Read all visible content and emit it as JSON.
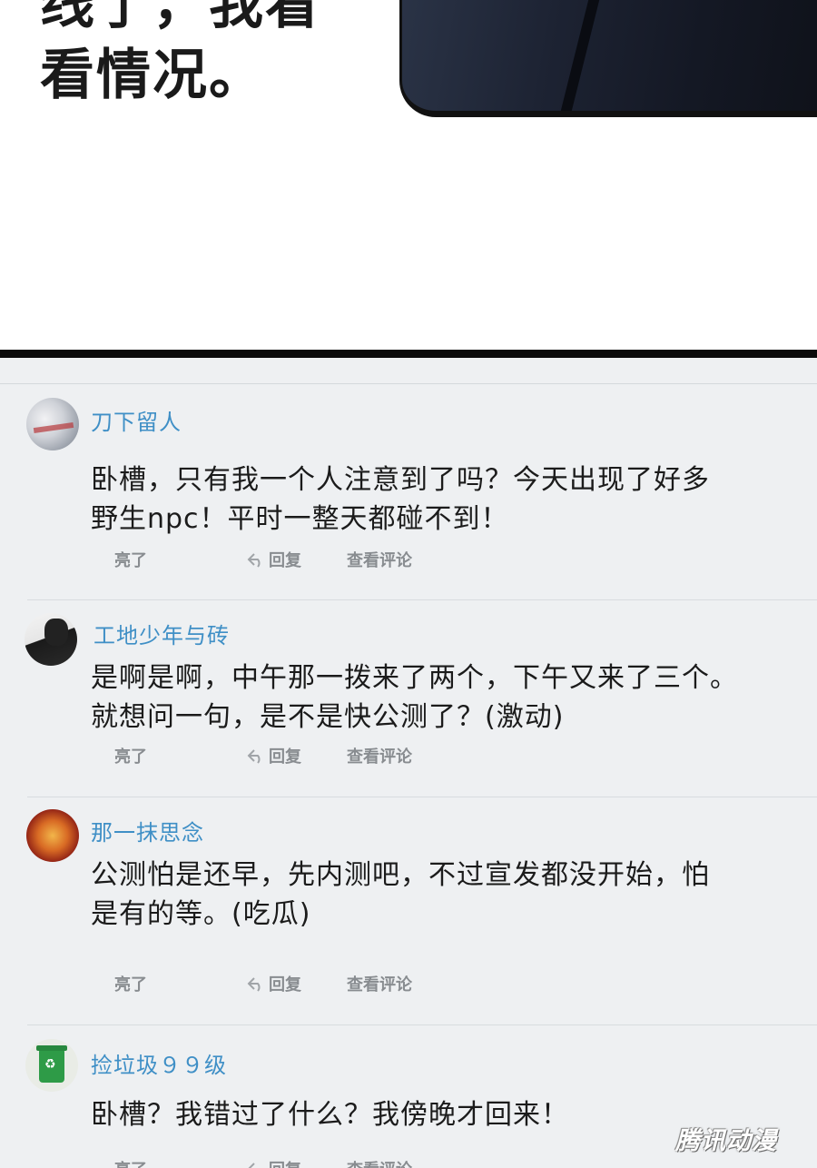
{
  "panel": {
    "bubble_lines": [
      "线了，我看",
      "看情况。"
    ]
  },
  "comments": [
    {
      "username": "刀下留人",
      "body_lines": [
        "卧槽，只有我一个人注意到了吗？今天出现了好多",
        "野生npc！平时一整天都碰不到！"
      ],
      "actions": {
        "like": "亮了",
        "reply": "回复",
        "view": "查看评论"
      }
    },
    {
      "username": "工地少年与砖",
      "body_lines": [
        "是啊是啊，中午那一拨来了两个，下午又来了三个。",
        "就想问一句，是不是快公测了？(激动)"
      ],
      "actions": {
        "like": "亮了",
        "reply": "回复",
        "view": "查看评论"
      }
    },
    {
      "username": "那一抹思念",
      "body_lines": [
        "公测怕是还早，先内测吧，不过宣发都没开始，怕",
        "是有的等。(吃瓜)"
      ],
      "actions": {
        "like": "亮了",
        "reply": "回复",
        "view": "查看评论"
      }
    },
    {
      "username": "捡垃圾９９级",
      "body_lines": [
        "卧槽？我错过了什么？我傍晚才回来！"
      ],
      "actions": {
        "like": "亮了",
        "reply": "回复",
        "view": "查看评论"
      }
    }
  ],
  "icons": {
    "reply": "reply-arrow-icon",
    "avatar4": "trash-bin-icon"
  },
  "colors": {
    "username": "#3f8fc6",
    "comments_bg": "#eef0f2",
    "divider": "#0b0b0b"
  },
  "watermark": "腾讯动漫"
}
